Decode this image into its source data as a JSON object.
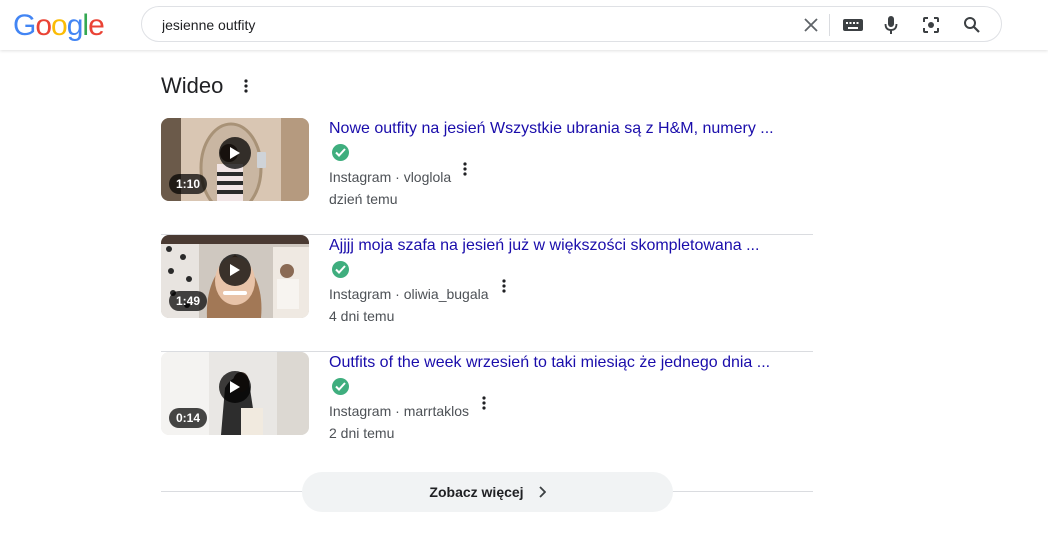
{
  "header": {
    "logo_letters": [
      {
        "ch": "G",
        "color": "#4285F4"
      },
      {
        "ch": "o",
        "color": "#EA4335"
      },
      {
        "ch": "o",
        "color": "#FBBC05"
      },
      {
        "ch": "g",
        "color": "#4285F4"
      },
      {
        "ch": "l",
        "color": "#34A853"
      },
      {
        "ch": "e",
        "color": "#EA4335"
      }
    ],
    "search": {
      "value": "jesienne outfity",
      "icons": [
        "clear-icon",
        "keyboard-icon",
        "microphone-icon",
        "lens-icon",
        "search-icon"
      ]
    }
  },
  "section": {
    "title": "Wideo",
    "more_icon": "more-vert-icon"
  },
  "videos": [
    {
      "title": "Nowe outfity na jesień Wszystkie ubrania są z H&M, numery ...",
      "duration": "1:10",
      "source": "Instagram · vloglola",
      "date": "dzień temu",
      "verified": true
    },
    {
      "title": "Ajjjj moja szafa na jesień już w większości skompletowana ...",
      "duration": "1:49",
      "source": "Instagram · oliwia_bugala",
      "date": "4 dni temu",
      "verified": true
    },
    {
      "title": "Outfits of the week  wrzesień to taki miesiąc że jednego dnia ...",
      "duration": "0:14",
      "source": "Instagram · marrtaklos",
      "date": "2 dni temu",
      "verified": true
    }
  ],
  "more_button": {
    "label": "Zobacz więcej"
  },
  "colors": {
    "link": "#1a0dab",
    "verified": "#3fae7e",
    "meta": "#4d5156"
  }
}
